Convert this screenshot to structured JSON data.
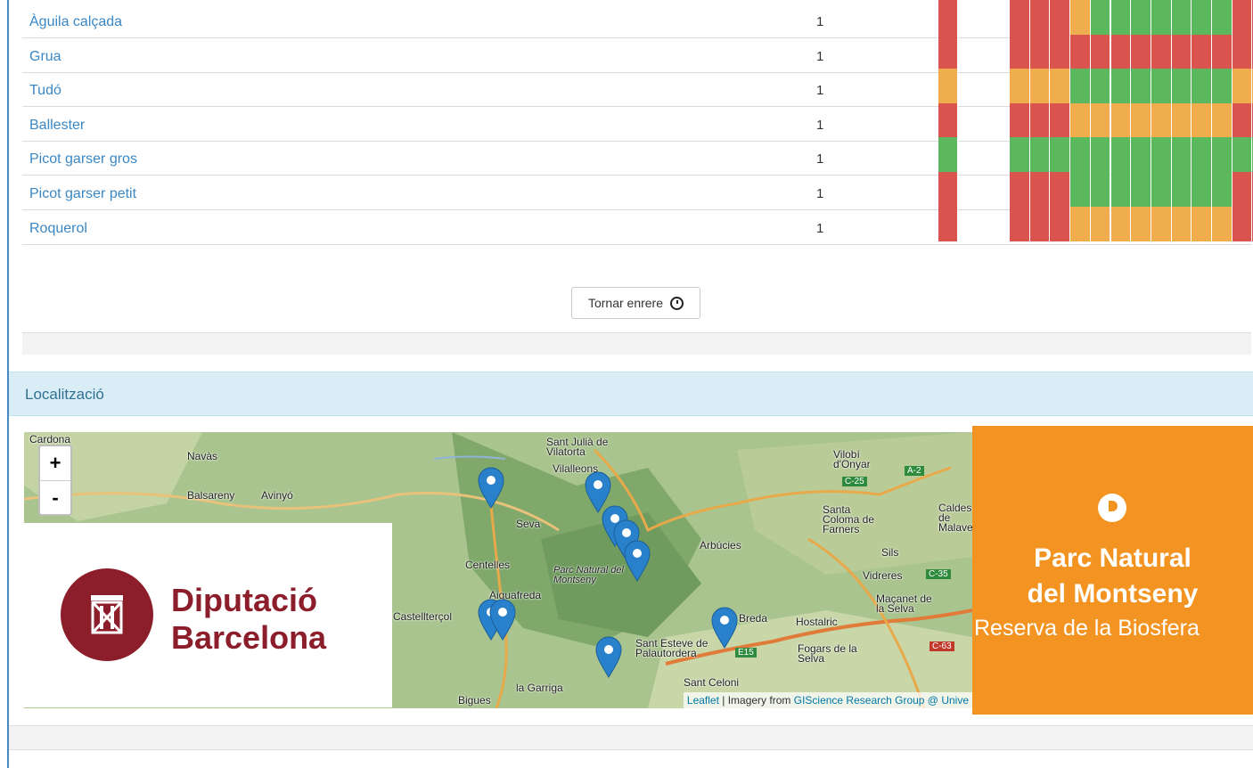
{
  "colors": {
    "red": "#d9534f",
    "orange": "#f0ad4e",
    "green": "#5cb85c",
    "link": "#3a87c4"
  },
  "species": [
    {
      "name": "Àguila calçada",
      "count": "1",
      "status": "r",
      "months": "rrrogggggggrr"
    },
    {
      "name": "Grua",
      "count": "1",
      "status": "r",
      "months": "rrrrrrrrrrrrr"
    },
    {
      "name": "Tudó",
      "count": "1",
      "status": "o",
      "months": "oooggggggggoo"
    },
    {
      "name": "Ballester",
      "count": "1",
      "status": "r",
      "months": "rrroooooooorr"
    },
    {
      "name": "Picot garser gros",
      "count": "1",
      "status": "g",
      "months": "ggggggggggggg"
    },
    {
      "name": "Picot garser petit",
      "count": "1",
      "status": "r",
      "months": "rrrggggggggrr"
    },
    {
      "name": "Roquerol",
      "count": "1",
      "status": "r",
      "months": "rrroooooooorr"
    }
  ],
  "back_button": {
    "label": "Tornar enrere",
    "icon": "clock-icon"
  },
  "location": {
    "heading": "Localització"
  },
  "map": {
    "zoom_in": "+",
    "zoom_out": "-",
    "attribution": {
      "leaflet": "Leaflet",
      "separator": " | Imagery from ",
      "source": "GIScience Research Group @ Unive"
    },
    "places": [
      "Cardona",
      "Navàs",
      "Balsareny",
      "Avinyó",
      "Sant Julià de Vilatorta",
      "Vilalleons",
      "Seva",
      "Centelles",
      "Parc Natural del Montseny",
      "Aiguafreda",
      "Arbúcies",
      "Breda",
      "Hostalric",
      "Sant Esteve de Palautordera",
      "Sant Celoni",
      "Fogars de la Selva",
      "la Garriga",
      "Bigues",
      "Vilobí d'Onyar",
      "Santa Coloma de Farners",
      "Sils",
      "Vidreres",
      "Maçanet de la Selva",
      "Caldes de Malavella",
      "Castellterçol"
    ],
    "roads": [
      "A-2",
      "C-25",
      "C-35",
      "C-63",
      "E15"
    ]
  },
  "logos": {
    "diputacio": [
      "Diputació",
      "Barcelona"
    ],
    "parc": [
      "Parc Natural",
      "del Montseny",
      "Reserva de la Biosfera"
    ]
  }
}
